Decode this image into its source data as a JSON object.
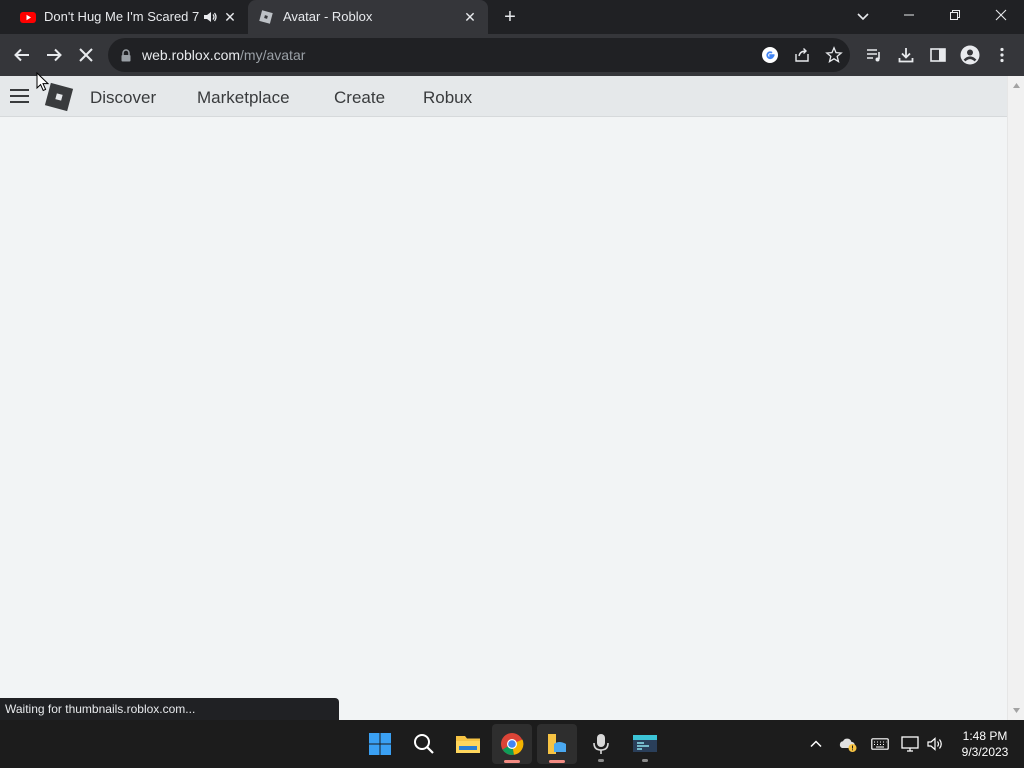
{
  "browser": {
    "tabs": [
      {
        "title": "Don't Hug Me I'm Scared 7 -",
        "favicon": "youtube-icon",
        "audio": true,
        "active": false
      },
      {
        "title": "Avatar - Roblox",
        "favicon": "roblox-icon",
        "active": true
      }
    ],
    "address": {
      "domain": "web.roblox.com",
      "path": "/my/avatar"
    },
    "loading": true,
    "status_text": "Waiting for thumbnails.roblox.com..."
  },
  "page": {
    "nav": {
      "discover": "Discover",
      "marketplace": "Marketplace",
      "create": "Create",
      "robux": "Robux"
    }
  },
  "taskbar": {
    "apps": [
      "windows-start-icon",
      "search-icon",
      "file-explorer-icon",
      "chrome-icon",
      "folder-app-icon",
      "microphone-app-icon",
      "terminal-app-icon"
    ],
    "time": "1:48 PM",
    "date": "9/3/2023"
  },
  "colors": {
    "page_bg": "#f2f4f5",
    "header_bg": "#e5e8ea",
    "browser_dark": "#202124",
    "browser_toolbar": "#35363a",
    "youtube_red": "#ff0000"
  }
}
